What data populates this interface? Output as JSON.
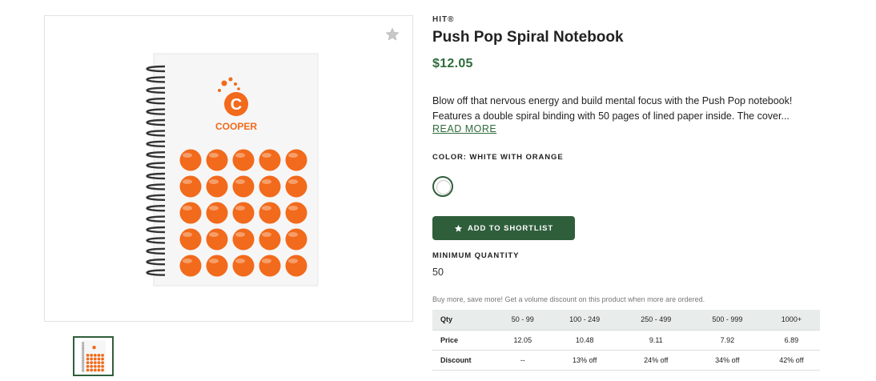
{
  "product": {
    "brand": "HIT®",
    "title": "Push Pop Spiral Notebook",
    "price": "$12.05",
    "description": "Blow off that nervous energy and build mental focus with the Push Pop notebook! Features a double spiral binding with 50 pages of lined paper inside. The cover...",
    "read_more": "READ MORE",
    "color_label": "COLOR: WHITE WITH ORANGE",
    "shortlist_button": "ADD TO SHORTLIST",
    "min_qty_label": "MINIMUM QUANTITY",
    "min_qty_value": "50",
    "volume_note": "Buy more, save more! Get a volume discount on this product when more are ordered."
  },
  "image": {
    "logo_text": "COOPER",
    "logo_letter": "C",
    "accent_color": "#f26a1b",
    "favorite_icon": "star-icon"
  },
  "pricing_table": {
    "headers": [
      "Qty",
      "50 - 99",
      "100 - 249",
      "250 - 499",
      "500 - 999",
      "1000+"
    ],
    "price_row": [
      "Price",
      "12.05",
      "10.48",
      "9.11",
      "7.92",
      "6.89"
    ],
    "discount_row": [
      "Discount",
      "--",
      "13% off",
      "24% off",
      "34% off",
      "42% off"
    ]
  },
  "colors": {
    "brand_green": "#2f5e3b",
    "price_green": "#2f6b3c",
    "table_header_bg": "#e8ecea"
  }
}
